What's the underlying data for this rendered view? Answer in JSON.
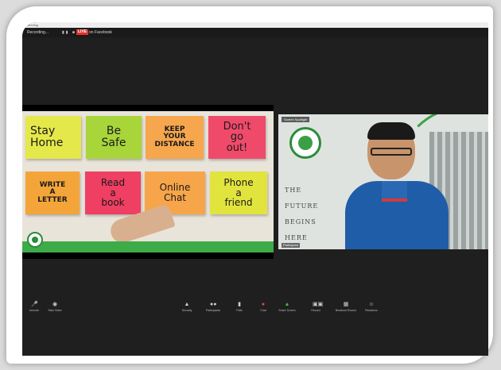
{
  "window": {
    "title": "Meeting"
  },
  "topbar": {
    "recording": "Recording...",
    "icons": [
      "pause-icon",
      "stop-icon"
    ],
    "live_badge": "LIVE",
    "live_target": "on Facebook"
  },
  "shared_screen": {
    "notes": [
      {
        "text": "Stay\nHome",
        "color": "#e5e84a"
      },
      {
        "text": "Be\nSafe",
        "color": "#a8d63a"
      },
      {
        "text": "KEEP\nYOUR\nDISTANCE",
        "color": "#f6a64c"
      },
      {
        "text": "Don't\ngo\nout!",
        "color": "#f04a6a"
      },
      {
        "text": "WRITE\nA\nLETTER",
        "color": "#f4a53a"
      },
      {
        "text": "Read\na\nbook",
        "color": "#ef3f63"
      },
      {
        "text": "Online\nChat",
        "color": "#f7a54a"
      },
      {
        "text": "Phone\na\nfriend",
        "color": "#e2e43e"
      }
    ],
    "bar_color": "#3dab48"
  },
  "camera": {
    "label": "Screen Spotlight",
    "footer": "Participant",
    "slogan": [
      "THE",
      "FUTURE",
      "BEGINS",
      "HERE"
    ]
  },
  "toolbar": {
    "items": [
      {
        "icon": "microphone-icon",
        "label": "Unmute"
      },
      {
        "icon": "video-camera-icon",
        "label": "Start Video"
      },
      {
        "icon": "shield-icon",
        "label": "Security"
      },
      {
        "icon": "participants-icon",
        "label": "Participants"
      },
      {
        "icon": "polls-icon",
        "label": "Polls"
      },
      {
        "icon": "chat-icon",
        "label": "Chat"
      },
      {
        "icon": "share-screen-icon",
        "label": "Share Screen"
      },
      {
        "icon": "record-icon",
        "label": "Record"
      },
      {
        "icon": "breakout-rooms-icon",
        "label": "Breakout Rooms"
      },
      {
        "icon": "reactions-icon",
        "label": "Reactions"
      }
    ]
  }
}
